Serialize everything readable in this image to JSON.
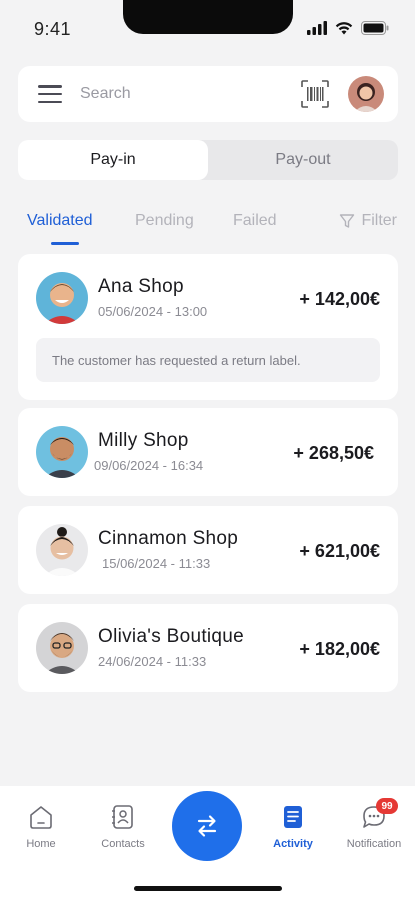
{
  "status_bar": {
    "time": "9:41",
    "icons": [
      "signal-icon",
      "wifi-icon",
      "battery-icon"
    ]
  },
  "search": {
    "placeholder": "Search",
    "value": ""
  },
  "segmented": {
    "options": [
      "Pay-in",
      "Pay-out"
    ],
    "selected": "Pay-in"
  },
  "tabs": {
    "items": [
      "Validated",
      "Pending",
      "Failed"
    ],
    "selected": "Validated",
    "filter_label": "Filter"
  },
  "transactions": [
    {
      "name": "Ana Shop",
      "date": "05/06/2024 - 13:00",
      "amount": "+ 142,00€",
      "note": "The customer has requested a return label."
    },
    {
      "name": "Milly Shop",
      "date": "09/06/2024 - 16:34",
      "amount": "+ 268,50€"
    },
    {
      "name": "Cinnamon Shop",
      "date": "15/06/2024 - 11:33",
      "amount": "+ 621,00€"
    },
    {
      "name": "Olivia's Boutique",
      "date": "24/06/2024 - 11:33",
      "amount": "+ 182,00€"
    }
  ],
  "bottom_nav": {
    "items": [
      {
        "label": "Home",
        "icon": "home-icon"
      },
      {
        "label": "Contacts",
        "icon": "contacts-icon"
      },
      {
        "label": "Activity",
        "icon": "activity-icon",
        "active": true
      },
      {
        "label": "Notification",
        "icon": "chat-bubble-icon",
        "badge": "99"
      }
    ],
    "fab_icon": "transfer-arrows-icon"
  },
  "colors": {
    "accent": "#1f5fd6",
    "fab": "#1f6fea",
    "badge": "#e53935",
    "background": "#f3f3f4"
  }
}
